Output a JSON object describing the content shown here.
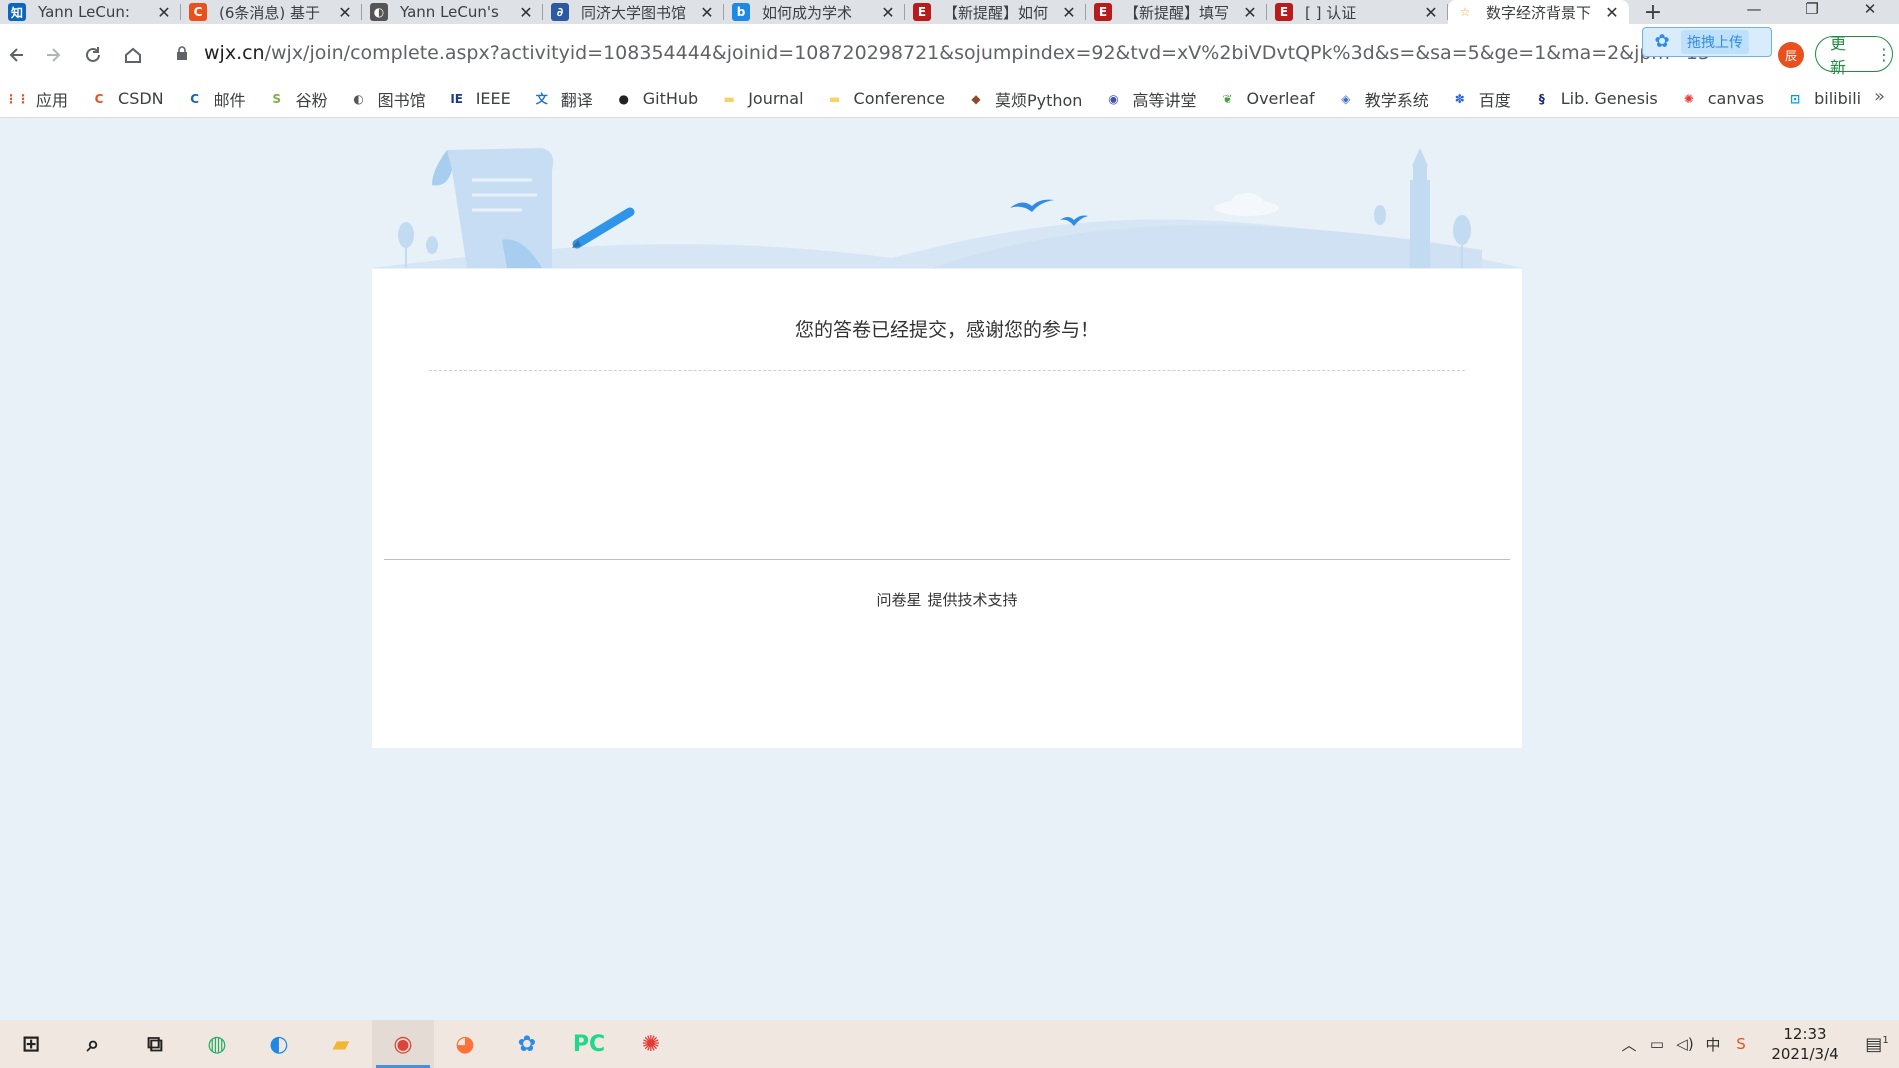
{
  "tabs": [
    {
      "title": "Yann LeCun:",
      "favicon": "zhihu-icon",
      "favicon_text": "知",
      "color": "#0a66c2"
    },
    {
      "title": "(6条消息) 基于",
      "favicon": "csdn-icon",
      "favicon_text": "C",
      "color": "#e8501e"
    },
    {
      "title": "Yann LeCun's",
      "favicon": "globe-icon",
      "favicon_text": "◐",
      "color": "#555555"
    },
    {
      "title": "同济大学图书馆",
      "favicon": "library-icon",
      "favicon_text": "∂",
      "color": "#2c5aa0"
    },
    {
      "title": "如何成为学术",
      "favicon": "bing-icon",
      "favicon_text": "b",
      "color": "#1e88e5"
    },
    {
      "title": "【新提醒】如何",
      "favicon": "forum-e-icon",
      "favicon_text": "E",
      "color": "#b71c1c"
    },
    {
      "title": "【新提醒】填写",
      "favicon": "forum-e-icon",
      "favicon_text": "E",
      "color": "#b71c1c"
    },
    {
      "title": "[       ] 认证",
      "favicon": "forum-e-icon",
      "favicon_text": "E",
      "color": "#b71c1c"
    },
    {
      "title": "数字经济背景下",
      "favicon": "star-outline-icon",
      "favicon_text": "☆",
      "color": "#f5a623",
      "active": true
    }
  ],
  "window_controls": {
    "minimize": "—",
    "maximize": "❐",
    "close": "✕"
  },
  "address": {
    "host": "wjx.cn",
    "path": "/wjx/join/complete.aspx?activityid=108354444&joinid=108720298721&sojumpindex=92&tvd=xV%2biVDvtQPk%3d&s=&sa=5&ge=1&ma=2&jpm=13"
  },
  "upload_extension": {
    "label": "拖拽上传"
  },
  "profile": {
    "initial": "辰"
  },
  "update_button": {
    "label": "更新"
  },
  "bookmarks": [
    {
      "label": "应用",
      "icon": "apps-grid-icon",
      "glyph": "⋮⋮",
      "color": "#e8501e"
    },
    {
      "label": "CSDN",
      "icon": "csdn-icon",
      "glyph": "C",
      "color": "#e8501e"
    },
    {
      "label": "邮件",
      "icon": "mail-icon",
      "glyph": "C",
      "color": "#1565c0"
    },
    {
      "label": "谷粉",
      "icon": "gufen-icon",
      "glyph": "S",
      "color": "#7cb342"
    },
    {
      "label": "图书馆",
      "icon": "globe-icon",
      "glyph": "◐",
      "color": "#555555"
    },
    {
      "label": "IEEE",
      "icon": "ieee-icon",
      "glyph": "IE",
      "color": "#1a3a8a"
    },
    {
      "label": "翻译",
      "icon": "translate-icon",
      "glyph": "文",
      "color": "#1976d2"
    },
    {
      "label": "GitHub",
      "icon": "github-icon",
      "glyph": "●",
      "color": "#222222"
    },
    {
      "label": "Journal",
      "icon": "folder-icon",
      "glyph": "▬",
      "color": "#f6d365"
    },
    {
      "label": "Conference",
      "icon": "folder-icon",
      "glyph": "▬",
      "color": "#f6d365"
    },
    {
      "label": "莫烦Python",
      "icon": "mofan-icon",
      "glyph": "◆",
      "color": "#8d4b2a"
    },
    {
      "label": "高等讲堂",
      "icon": "seal-icon",
      "glyph": "◉",
      "color": "#3f51b5"
    },
    {
      "label": "Overleaf",
      "icon": "overleaf-icon",
      "glyph": "❦",
      "color": "#47a141"
    },
    {
      "label": "教学系统",
      "icon": "diamond-icon",
      "glyph": "◈",
      "color": "#3a6fc4"
    },
    {
      "label": "百度",
      "icon": "baidu-paw-icon",
      "glyph": "✽",
      "color": "#2a62d9"
    },
    {
      "label": "Lib. Genesis",
      "icon": "libgen-icon",
      "glyph": "§",
      "color": "#1a237e"
    },
    {
      "label": "canvas",
      "icon": "canvas-icon",
      "glyph": "✺",
      "color": "#e53935"
    },
    {
      "label": "bilibili",
      "icon": "bilibili-icon",
      "glyph": "⊡",
      "color": "#00a1d6"
    }
  ],
  "bookmarks_more": "»",
  "page": {
    "message": "您的答卷已经提交，感谢您的参与！",
    "footer_brand": "问卷星",
    "footer_text": "提供技术支持"
  },
  "taskbar": {
    "apps": [
      {
        "name": "start-icon",
        "active": false
      },
      {
        "name": "search-icon",
        "active": false
      },
      {
        "name": "task-view-icon",
        "active": false
      },
      {
        "name": "wechat-icon",
        "active": false
      },
      {
        "name": "edge-icon",
        "active": false
      },
      {
        "name": "file-explorer-icon",
        "active": false
      },
      {
        "name": "chrome-icon",
        "active": true
      },
      {
        "name": "firefox-icon",
        "active": false
      },
      {
        "name": "baidu-netdisk-icon",
        "active": false
      },
      {
        "name": "pycharm-icon",
        "active": false
      },
      {
        "name": "huawei-icon",
        "active": false
      }
    ],
    "time": "12:33",
    "date": "2021/3/4",
    "notification_count": "1"
  }
}
